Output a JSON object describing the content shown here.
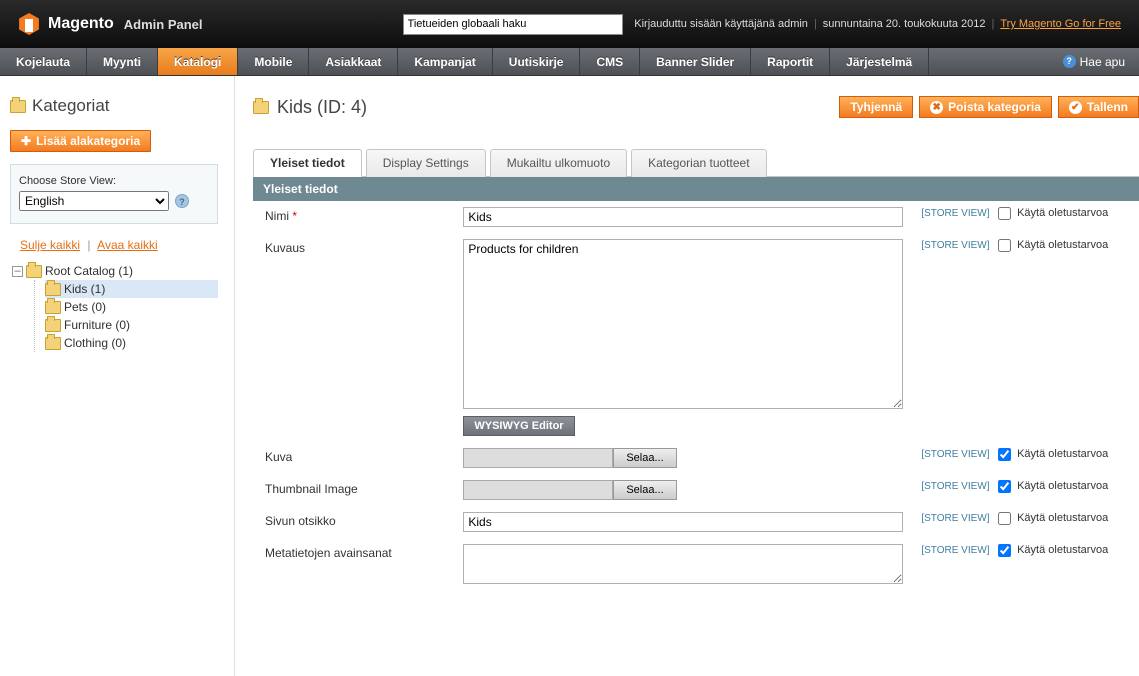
{
  "header": {
    "logo_text": "Magento",
    "logo_sub": "Admin Panel",
    "search_value": "Tietueiden globaali haku",
    "logged_in": "Kirjauduttu sisään käyttäjänä admin",
    "date": "sunnuntaina 20. toukokuuta 2012",
    "promo_link": "Try Magento Go for Free"
  },
  "nav": {
    "items": [
      "Kojelauta",
      "Myynti",
      "Katalogi",
      "Mobile",
      "Asiakkaat",
      "Kampanjat",
      "Uutiskirje",
      "CMS",
      "Banner Slider",
      "Raportit",
      "Järjestelmä"
    ],
    "active_index": 2,
    "help": "Hae apu"
  },
  "sidebar": {
    "title": "Kategoriat",
    "add_sub": "Lisää alakategoria",
    "store_label": "Choose Store View:",
    "store_value": "English",
    "collapse": "Sulje kaikki",
    "expand": "Avaa kaikki",
    "root": "Root Catalog (1)",
    "children": [
      "Kids (1)",
      "Pets (0)",
      "Furniture (0)",
      "Clothing (0)"
    ],
    "selected_child": 0
  },
  "main": {
    "title": "Kids (ID: 4)",
    "actions": {
      "reset": "Tyhjennä",
      "delete": "Poista kategoria",
      "save": "Tallenn"
    },
    "tabs": [
      "Yleiset tiedot",
      "Display Settings",
      "Mukailtu ulkomuoto",
      "Kategorian tuotteet"
    ],
    "active_tab": 0,
    "section_title": "Yleiset tiedot"
  },
  "form": {
    "scope_label": "[STORE VIEW]",
    "use_default": "Käytä oletustarvoa",
    "browse": "Selaa...",
    "wysiwyg": "WYSIWYG Editor",
    "fields": {
      "name": {
        "label": "Nimi",
        "value": "Kids",
        "required": true,
        "type": "text",
        "default_checked": false
      },
      "desc": {
        "label": "Kuvaus",
        "value": "Products for children",
        "type": "textarea",
        "default_checked": false
      },
      "image": {
        "label": "Kuva",
        "type": "file",
        "default_checked": true
      },
      "thumb": {
        "label": "Thumbnail Image",
        "type": "file",
        "default_checked": true
      },
      "page_title": {
        "label": "Sivun otsikko",
        "value": "Kids",
        "type": "text",
        "default_checked": false
      },
      "meta_kw": {
        "label": "Metatietojen avainsanat",
        "value": "",
        "type": "textarea",
        "default_checked": true
      }
    }
  }
}
